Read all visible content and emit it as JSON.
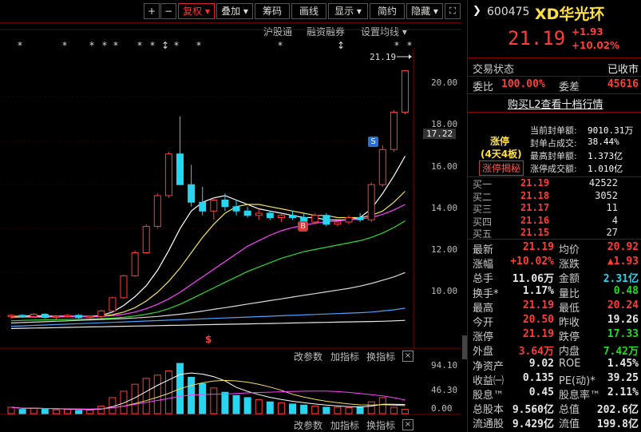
{
  "toolbar": {
    "plus": "+",
    "minus": "−",
    "fuquan": "复权",
    "diejia": "叠加",
    "choumao": "筹码",
    "huaxian": "画线",
    "xianshi": "显示",
    "jianyue": "简约",
    "yincang": "隐藏"
  },
  "subbar": {
    "hgt": "沪股通",
    "rzrq": "融资融券",
    "setma": "设置均线"
  },
  "chart": {
    "price_tag": "21.19",
    "last_price_label": "17.22",
    "yaxis": [
      "20.00",
      "18.00",
      "16.00",
      "14.00",
      "12.00",
      "10.00"
    ],
    "vol_yaxis": [
      "94.10",
      "46.30",
      "0.00"
    ],
    "buy_marker": "B",
    "sell_marker": "S",
    "dollar_marker": "$",
    "mid_tools": {
      "gai": "改参数",
      "jia": "加指标",
      "huan": "换指标",
      "close": "×"
    },
    "bottom_tools": {
      "gai": "改参数",
      "jia": "加指标",
      "huan": "换指标",
      "close": "×"
    },
    "stars": [
      "*",
      "*",
      "*",
      "*",
      "*",
      "*",
      "*",
      "↕",
      "*",
      "*",
      "*",
      "↕",
      "*",
      "*"
    ]
  },
  "chart_data": {
    "type": "candlestick",
    "note_scale": "price axis 9.5-21.5",
    "ylim": [
      9.5,
      21.5
    ],
    "candles": [
      [
        10.0,
        10.1,
        9.9,
        10.05
      ],
      [
        10.05,
        10.1,
        9.95,
        10.0
      ],
      [
        10.0,
        10.15,
        9.95,
        10.1
      ],
      [
        10.1,
        10.15,
        9.9,
        9.95
      ],
      [
        9.95,
        10.05,
        9.85,
        10.0
      ],
      [
        10.0,
        10.1,
        9.95,
        10.05
      ],
      [
        10.05,
        10.1,
        9.9,
        9.95
      ],
      [
        9.95,
        10.05,
        9.9,
        10.0
      ],
      [
        10.0,
        10.3,
        9.9,
        10.25
      ],
      [
        10.25,
        10.9,
        10.2,
        10.85
      ],
      [
        10.85,
        11.9,
        10.8,
        11.85
      ],
      [
        11.85,
        13.0,
        11.8,
        12.9
      ],
      [
        12.9,
        14.2,
        12.85,
        14.1
      ],
      [
        14.1,
        15.6,
        14.0,
        15.5
      ],
      [
        15.5,
        17.5,
        15.4,
        17.4
      ],
      [
        17.4,
        19.1,
        17.0,
        16.0
      ],
      [
        16.0,
        16.9,
        15.0,
        15.2
      ],
      [
        15.2,
        15.9,
        14.6,
        14.8
      ],
      [
        14.8,
        15.4,
        14.4,
        15.3
      ],
      [
        15.3,
        15.6,
        14.8,
        15.0
      ],
      [
        15.0,
        15.3,
        14.6,
        14.8
      ],
      [
        14.8,
        15.0,
        14.5,
        14.6
      ],
      [
        14.6,
        14.9,
        14.4,
        14.7
      ],
      [
        14.7,
        14.8,
        14.4,
        14.5
      ],
      [
        14.5,
        14.7,
        14.3,
        14.6
      ],
      [
        14.6,
        14.8,
        14.4,
        14.5
      ],
      [
        14.5,
        14.7,
        14.2,
        14.3
      ],
      [
        14.3,
        14.7,
        14.2,
        14.6
      ],
      [
        14.6,
        14.7,
        14.1,
        14.2
      ],
      [
        14.2,
        14.4,
        14.1,
        14.3
      ],
      [
        14.3,
        14.6,
        14.2,
        14.5
      ],
      [
        14.5,
        14.7,
        14.3,
        14.4
      ],
      [
        14.4,
        16.1,
        14.3,
        16.0
      ],
      [
        16.0,
        17.8,
        15.9,
        17.6
      ],
      [
        17.6,
        19.4,
        17.5,
        19.3
      ],
      [
        19.3,
        21.19,
        19.2,
        21.19
      ]
    ],
    "ma_series": [
      {
        "color": "#ffffff",
        "values": [
          10.0,
          10.02,
          10.03,
          10.02,
          10.01,
          10.01,
          10.0,
          10.0,
          10.05,
          10.2,
          10.5,
          10.9,
          11.4,
          12.1,
          13.0,
          14.0,
          14.8,
          15.2,
          15.4,
          15.5,
          15.3,
          15.1,
          14.9,
          14.8,
          14.7,
          14.6,
          14.5,
          14.5,
          14.4,
          14.4,
          14.4,
          14.5,
          14.9,
          15.6,
          16.4,
          17.3
        ]
      },
      {
        "color": "#f2e25a",
        "values": [
          10.0,
          10.0,
          10.01,
          10.01,
          10.01,
          10.01,
          10.01,
          10.01,
          10.02,
          10.08,
          10.2,
          10.4,
          10.7,
          11.1,
          11.6,
          12.2,
          12.9,
          13.6,
          14.2,
          14.7,
          15.0,
          15.1,
          15.1,
          15.0,
          14.9,
          14.8,
          14.7,
          14.6,
          14.6,
          14.5,
          14.5,
          14.5,
          14.6,
          14.8,
          15.2,
          15.7
        ]
      },
      {
        "color": "#ff40ff",
        "values": [
          9.95,
          9.96,
          9.97,
          9.97,
          9.98,
          9.98,
          9.99,
          9.99,
          10.0,
          10.03,
          10.1,
          10.2,
          10.35,
          10.55,
          10.8,
          11.1,
          11.45,
          11.8,
          12.15,
          12.5,
          12.85,
          13.2,
          13.45,
          13.7,
          13.9,
          14.05,
          14.15,
          14.25,
          14.3,
          14.35,
          14.4,
          14.45,
          14.5,
          14.65,
          14.85,
          15.1
        ]
      },
      {
        "color": "#30d830",
        "values": [
          9.8,
          9.82,
          9.83,
          9.84,
          9.85,
          9.86,
          9.87,
          9.88,
          9.9,
          9.92,
          9.96,
          10.02,
          10.1,
          10.2,
          10.35,
          10.55,
          10.8,
          11.05,
          11.3,
          11.55,
          11.8,
          12.05,
          12.25,
          12.45,
          12.65,
          12.8,
          12.95,
          13.05,
          13.15,
          13.25,
          13.35,
          13.45,
          13.6,
          13.8,
          14.05,
          14.35
        ]
      },
      {
        "color": "#d8d8d8",
        "values": [
          9.7,
          9.72,
          9.74,
          9.76,
          9.78,
          9.8,
          9.82,
          9.84,
          9.86,
          9.88,
          9.9,
          9.93,
          9.96,
          10.0,
          10.05,
          10.1,
          10.17,
          10.24,
          10.32,
          10.4,
          10.48,
          10.56,
          10.64,
          10.72,
          10.8,
          10.88,
          10.96,
          11.04,
          11.12,
          11.2,
          11.28,
          11.38,
          11.5,
          11.65,
          11.8,
          12.0
        ]
      },
      {
        "color": "#4aa3ff",
        "values": [
          9.55,
          9.57,
          9.59,
          9.61,
          9.63,
          9.65,
          9.67,
          9.69,
          9.71,
          9.73,
          9.75,
          9.77,
          9.79,
          9.81,
          9.83,
          9.85,
          9.87,
          9.89,
          9.91,
          9.93,
          9.95,
          9.97,
          9.99,
          10.01,
          10.03,
          10.05,
          10.07,
          10.09,
          10.11,
          10.13,
          10.15,
          10.17,
          10.2,
          10.25,
          10.3,
          10.38
        ]
      },
      {
        "color": "#e8e8e8",
        "values": [
          9.45,
          9.46,
          9.47,
          9.48,
          9.49,
          9.5,
          9.51,
          9.52,
          9.53,
          9.54,
          9.55,
          9.56,
          9.57,
          9.58,
          9.59,
          9.6,
          9.61,
          9.62,
          9.63,
          9.64,
          9.65,
          9.66,
          9.67,
          9.68,
          9.69,
          9.7,
          9.71,
          9.72,
          9.73,
          9.74,
          9.75,
          9.76,
          9.77,
          9.78,
          9.8,
          9.82
        ]
      }
    ],
    "volume": [
      12,
      8,
      10,
      9,
      7,
      8,
      6,
      7,
      14,
      30,
      42,
      55,
      66,
      72,
      80,
      94,
      68,
      56,
      48,
      40,
      34,
      30,
      26,
      22,
      20,
      18,
      16,
      14,
      12,
      12,
      11,
      13,
      22,
      30,
      12,
      8
    ],
    "vol_ylim": [
      0,
      94.1
    ]
  },
  "quote": {
    "code": "600475",
    "name": "XD华光环",
    "price": "21.19",
    "change": "+1.93",
    "pct": "+10.02%",
    "trade_state_k": "交易状态",
    "trade_state_v": "已收市",
    "weibi_k": "委比",
    "weibi_v": "100.00%",
    "weicha_k": "委差",
    "weicha_v": "45616",
    "l2": "购买L2查看十档行情",
    "zt_title": "涨停",
    "zt_days": "(4天4板)",
    "zt_reveal": "涨停揭秘",
    "fengdan": [
      {
        "k": "当前封单额:",
        "v": "9010.31万"
      },
      {
        "k": "封单占成交:",
        "v": "38.44%"
      },
      {
        "k": "最高封单额:",
        "v": "1.373亿"
      },
      {
        "k": "涨停成交额:",
        "v": "1.010亿"
      }
    ],
    "buy": [
      {
        "k": "买一",
        "p": "21.19",
        "v": "42522"
      },
      {
        "k": "买二",
        "p": "21.18",
        "v": "3052"
      },
      {
        "k": "买三",
        "p": "21.17",
        "v": "11"
      },
      {
        "k": "买四",
        "p": "21.16",
        "v": "4"
      },
      {
        "k": "买五",
        "p": "21.15",
        "v": "27"
      }
    ],
    "stats": [
      {
        "k1": "最新",
        "v1": "21.19",
        "c1": "red",
        "k2": "均价",
        "v2": "20.92",
        "c2": "red"
      },
      {
        "k1": "涨幅",
        "v1": "+10.02%",
        "c1": "red",
        "k2": "涨跌",
        "v2": "▲1.93",
        "c2": "red"
      },
      {
        "k1": "总手",
        "v1": "11.06万",
        "c1": "white",
        "k2": "金额",
        "v2": "2.31亿",
        "c2": "cyan"
      },
      {
        "k1": "换手*",
        "v1": "1.17%",
        "c1": "white",
        "k2": "量比",
        "v2": "0.48",
        "c2": "green"
      },
      {
        "k1": "最高",
        "v1": "21.19",
        "c1": "red",
        "k2": "最低",
        "v2": "20.24",
        "c2": "red"
      },
      {
        "k1": "今开",
        "v1": "20.50",
        "c1": "red",
        "k2": "昨收",
        "v2": "19.26",
        "c2": "white"
      },
      {
        "k1": "涨停",
        "v1": "21.19",
        "c1": "red",
        "k2": "跌停",
        "v2": "17.33",
        "c2": "green"
      },
      {
        "k1": "外盘",
        "v1": "3.64万",
        "c1": "red",
        "k2": "内盘",
        "v2": "7.42万",
        "c2": "green"
      },
      {
        "k1": "净资产",
        "v1": "9.02",
        "c1": "white",
        "k2": "ROE",
        "v2": "1.45%",
        "c2": "white"
      },
      {
        "k1": "收益㈠",
        "v1": "0.135",
        "c1": "white",
        "k2": "PE(动)*",
        "v2": "39.25",
        "c2": "white"
      },
      {
        "k1": "股息™",
        "v1": "0.45",
        "c1": "white",
        "k2": "股息率™",
        "v2": "2.11%",
        "c2": "white"
      },
      {
        "k1": "总股本",
        "v1": "9.560亿",
        "c1": "white",
        "k2": "总值",
        "v2": "202.6亿",
        "c2": "white"
      },
      {
        "k1": "流通股",
        "v1": "9.429亿",
        "c1": "white",
        "k2": "流值",
        "v2": "199.8亿",
        "c2": "white"
      }
    ]
  }
}
